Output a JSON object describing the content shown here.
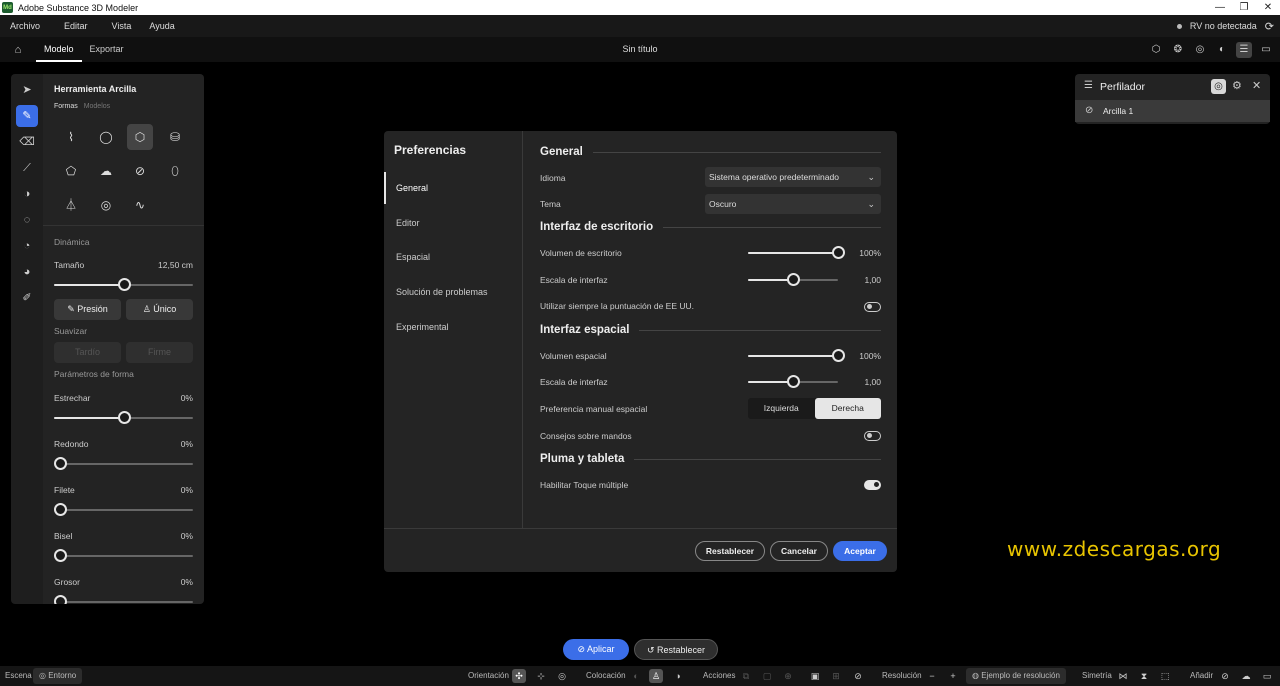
{
  "window": {
    "title": "Adobe Substance 3D Modeler",
    "logo_text": "Md",
    "controls": [
      "—",
      "❐",
      "✕"
    ]
  },
  "menubar": {
    "items": [
      "Archivo",
      "Editar",
      "Vista",
      "Ayuda"
    ],
    "vr_status": "RV no detectada"
  },
  "toolbar": {
    "tabs": [
      "Modelo",
      "Exportar"
    ],
    "active_tab": "Modelo",
    "document_title": "Sin título"
  },
  "tool_panel": {
    "title": "Herramienta Arcilla",
    "subtabs": [
      "Formas",
      "Modelos"
    ],
    "dynamics_label": "Dinámica",
    "size_label": "Tamaño",
    "size_value": "12,50 cm",
    "size_fraction": 0.5,
    "pressure_label": "Presión",
    "unique_label": "Único",
    "smooth_label": "Suavizar",
    "late_label": "Tardío",
    "firm_label": "Firme",
    "shape_params_label": "Parámetros de forma",
    "params": [
      {
        "label": "Estrechar",
        "value": "0%",
        "fraction": 0.5
      },
      {
        "label": "Redondo",
        "value": "0%",
        "fraction": 0.0
      },
      {
        "label": "Filete",
        "value": "0%",
        "fraction": 0.0
      },
      {
        "label": "Bisel",
        "value": "0%",
        "fraction": 0.0
      },
      {
        "label": "Grosor",
        "value": "0%",
        "fraction": 0.0
      }
    ]
  },
  "preferences": {
    "title": "Preferencias",
    "nav": [
      "General",
      "Editor",
      "Espacial",
      "Solución de problemas",
      "Experimental"
    ],
    "active_nav": "General",
    "sections": {
      "general": "General",
      "desktop": "Interfaz de escritorio",
      "spatial": "Interfaz espacial",
      "pen": "Pluma y tableta"
    },
    "language_label": "Idioma",
    "language_value": "Sistema operativo predeterminado",
    "theme_label": "Tema",
    "theme_value": "Oscuro",
    "desktop_volume_label": "Volumen de escritorio",
    "desktop_volume_value": "100%",
    "desktop_volume_fraction": 1.0,
    "desktop_scale_label": "Escala de interfaz",
    "desktop_scale_value": "1,00",
    "desktop_scale_fraction": 0.5,
    "us_punct_label": "Utilizar siempre la puntuación de EE UU.",
    "us_punct_on": false,
    "spatial_volume_label": "Volumen espacial",
    "spatial_volume_value": "100%",
    "spatial_volume_fraction": 1.0,
    "spatial_scale_label": "Escala de interfaz",
    "spatial_scale_value": "1,00",
    "spatial_scale_fraction": 0.5,
    "hand_pref_label": "Preferencia manual espacial",
    "hand_left": "Izquierda",
    "hand_right": "Derecha",
    "hand_selected": "Derecha",
    "controller_tips_label": "Consejos sobre mandos",
    "controller_tips_on": false,
    "multitouch_label": "Habilitar Toque múltiple",
    "multitouch_on": true,
    "reset_button": "Restablecer",
    "cancel_button": "Cancelar",
    "accept_button": "Aceptar"
  },
  "profiler": {
    "title": "Perfilador",
    "layer": "Arcilla 1"
  },
  "watermark": "www.zdescargas.org",
  "actions": {
    "apply": "Aplicar",
    "reset": "Restablecer"
  },
  "statusbar": {
    "scene": "Escena",
    "environment": "Entorno",
    "orientation": "Orientación",
    "placement": "Colocación",
    "actions": "Acciones",
    "resolution": "Resolución",
    "resolution_sample": "Ejemplo de resolución",
    "symmetry": "Simetría",
    "add": "Añadir"
  },
  "colors": {
    "accent": "#3b6ee8",
    "watermark": "#e8c400",
    "panel": "#232323",
    "background": "#000000"
  }
}
